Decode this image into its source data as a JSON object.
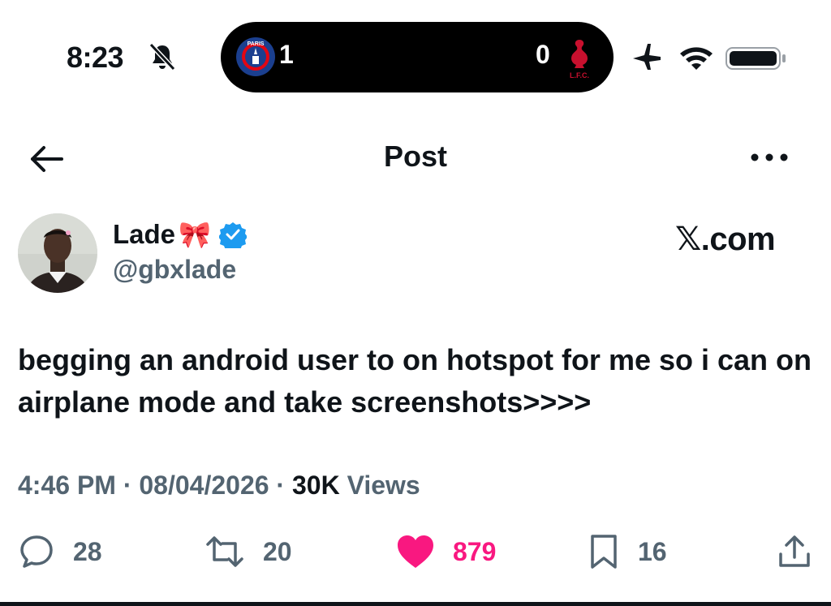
{
  "status_bar": {
    "time": "8:23",
    "live_score": {
      "home_score": "1",
      "away_score": "0",
      "home_crest_text": "PARIS",
      "away_crest_text": "L.F.C."
    }
  },
  "nav": {
    "title": "Post"
  },
  "author": {
    "display_name": "Lade",
    "emoji": "🎀",
    "handle": "@gbxlade",
    "verified": true
  },
  "watermark": "𝕏.com",
  "post": {
    "text": "begging an android user to on hotspot for me so i can on airplane mode and take screenshots>>>>",
    "time": "4:46 PM",
    "date": "08/04/2026",
    "separator": " · ",
    "views_count": "30K",
    "views_label": "Views"
  },
  "actions": {
    "replies": "28",
    "reposts": "20",
    "likes": "879",
    "bookmarks": "16"
  },
  "colors": {
    "like": "#f91880",
    "verified": "#1d9bf0",
    "secondary_text": "#536471",
    "primary_text": "#0f1419"
  }
}
